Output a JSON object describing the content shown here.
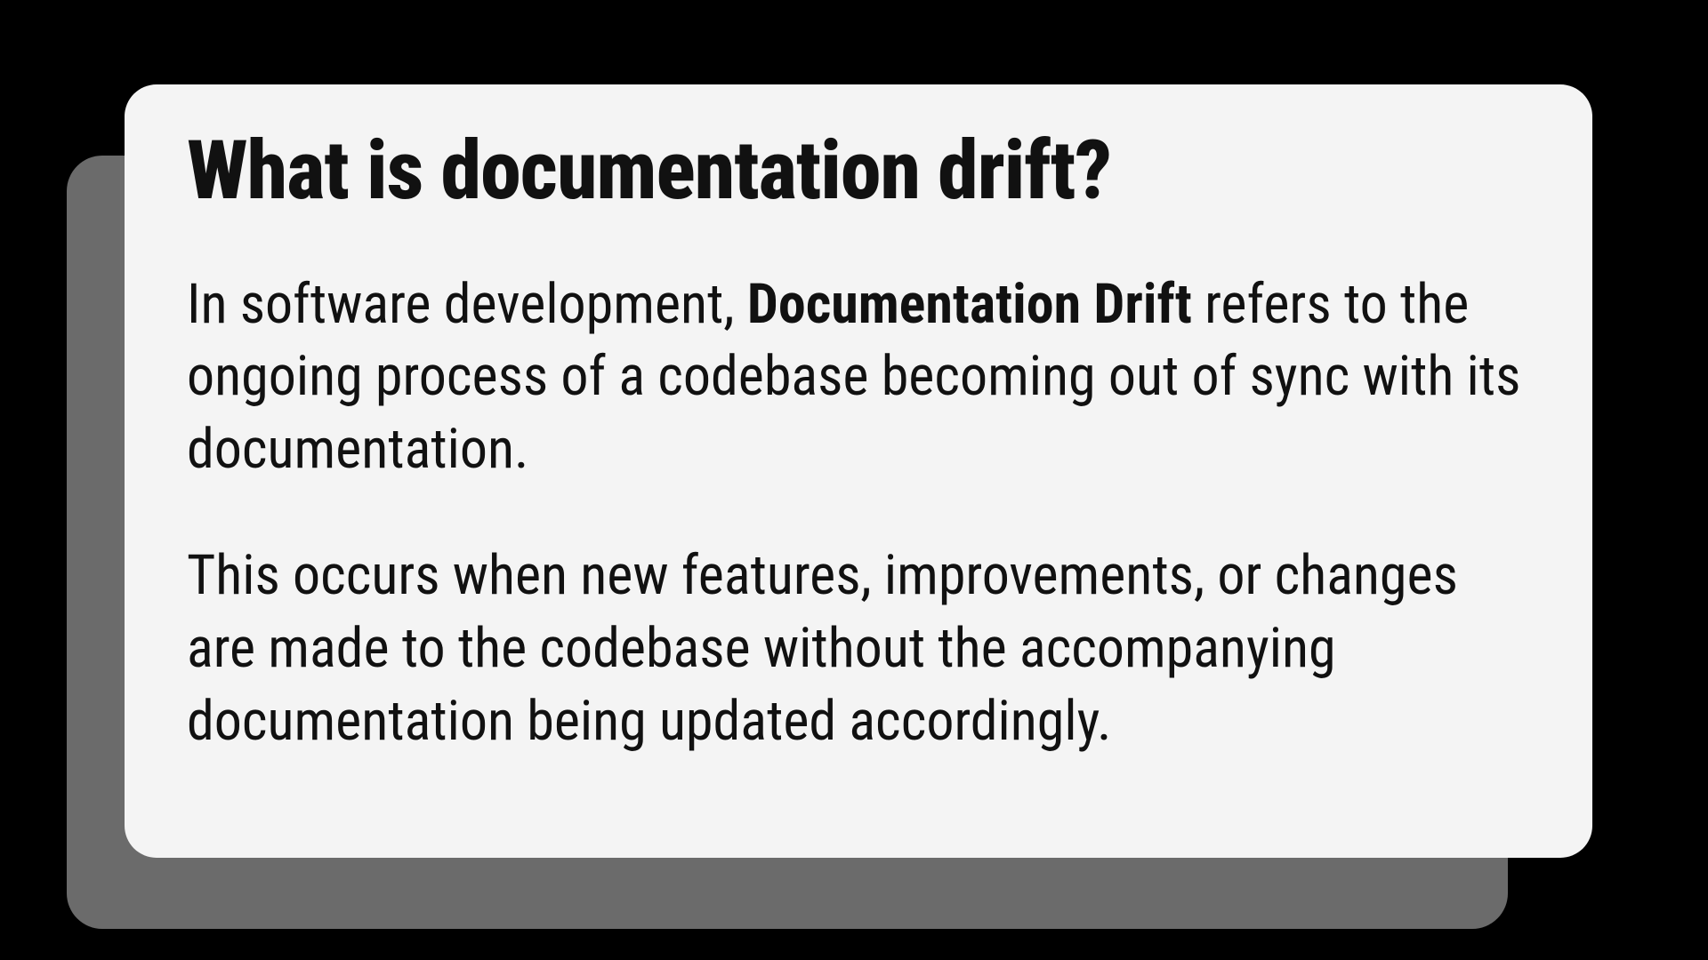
{
  "card": {
    "title": "What is documentation drift?",
    "p1_pre": "In software development, ",
    "p1_bold": "Documentation Drift",
    "p1_post": " refers to the ongoing process of a codebase becoming out of sync with its documentation.",
    "p2": "This occurs when new features, improvements, or changes are made to the codebase without the accompanying documentation being updated accordingly."
  }
}
